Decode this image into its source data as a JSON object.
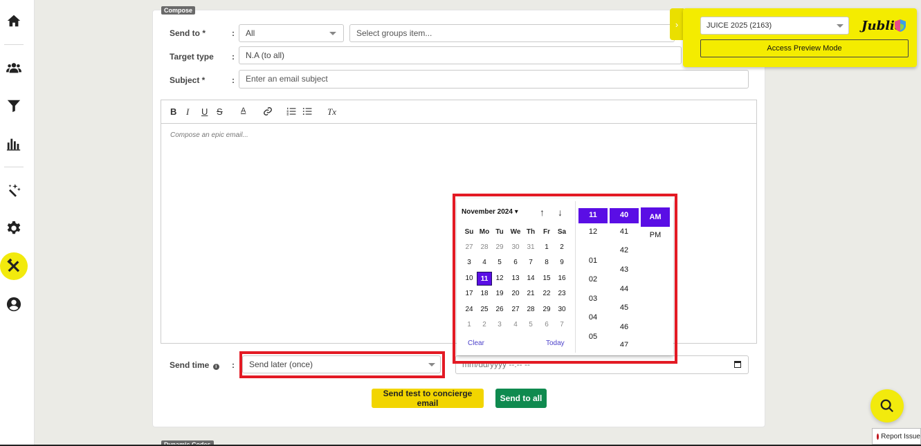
{
  "compose_tag": "Compose",
  "dynamic_tag": "Dynamic Codes",
  "form": {
    "send_to_label": "Send to *",
    "send_to_value": "All",
    "groups_placeholder": "Select groups item...",
    "target_type_label": "Target type",
    "target_type_value": "N.A (to all)",
    "subject_label": "Subject *",
    "subject_placeholder": "Enter an email subject",
    "colon": ":"
  },
  "editor": {
    "placeholder": "Compose an epic email...",
    "toolbar": {
      "bold": "B",
      "italic": "I",
      "underline": "U",
      "strike": "S",
      "color": "A",
      "clear": "Tx"
    }
  },
  "send_time": {
    "label": "Send time",
    "value": "Send later (once)",
    "datetime_placeholder": "mm/dd/yyyy --:-- --"
  },
  "buttons": {
    "send_test": "Send test to concierge email",
    "send_all": "Send to all"
  },
  "calendar": {
    "month_label": "November 2024 ▾",
    "dow": [
      "Su",
      "Mo",
      "Tu",
      "We",
      "Th",
      "Fr",
      "Sa"
    ],
    "weeks": [
      [
        "27",
        "28",
        "29",
        "30",
        "31",
        "1",
        "2"
      ],
      [
        "3",
        "4",
        "5",
        "6",
        "7",
        "8",
        "9"
      ],
      [
        "10",
        "11",
        "12",
        "13",
        "14",
        "15",
        "16"
      ],
      [
        "17",
        "18",
        "19",
        "20",
        "21",
        "22",
        "23"
      ],
      [
        "24",
        "25",
        "26",
        "27",
        "28",
        "29",
        "30"
      ],
      [
        "1",
        "2",
        "3",
        "4",
        "5",
        "6",
        "7"
      ]
    ],
    "selected_day": "11",
    "clear": "Clear",
    "today": "Today"
  },
  "time": {
    "hours": [
      "11",
      "12",
      "01",
      "02",
      "03",
      "04",
      "05"
    ],
    "minutes": [
      "40",
      "41",
      "42",
      "43",
      "44",
      "45",
      "46",
      "47"
    ],
    "ampm": [
      "AM",
      "PM"
    ],
    "selected_hour": "11",
    "selected_minute": "40",
    "selected_ampm": "AM"
  },
  "preview_panel": {
    "event": "JUICE 2025 (2163)",
    "button": "Access Preview Mode",
    "logo": "Jublia"
  },
  "report": "Report Issue",
  "colors": {
    "accent": "#5a0ee5",
    "yellow": "#f4ec00",
    "green": "#0f8a4f",
    "highlight": "#e31a24"
  }
}
